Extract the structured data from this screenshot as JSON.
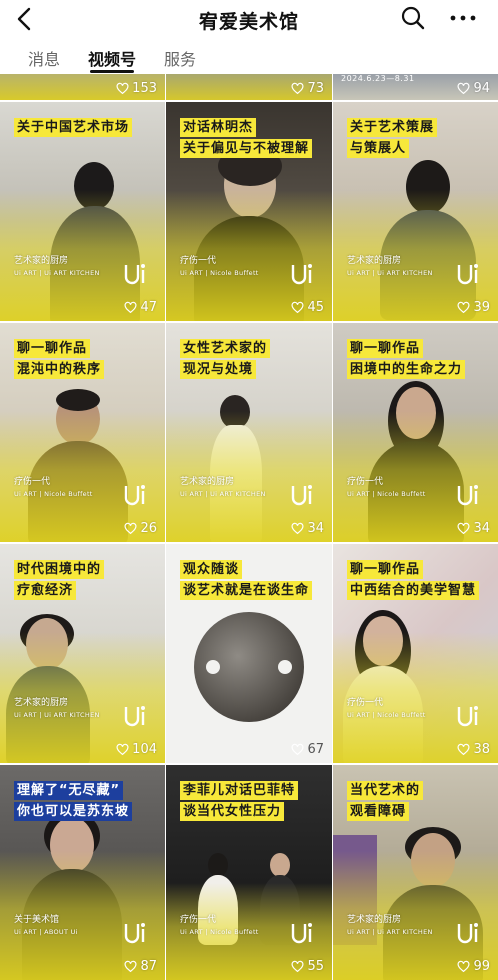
{
  "header": {
    "title": "宥爱美术馆"
  },
  "tabs": [
    {
      "label": "消息",
      "active": false
    },
    {
      "label": "视频号",
      "active": true
    },
    {
      "label": "服务",
      "active": false
    }
  ],
  "top_row": [
    {
      "likes": "153"
    },
    {
      "likes": "73"
    },
    {
      "likes": "94",
      "banner_text": "2024.6.23—8.31"
    }
  ],
  "videos": [
    {
      "caption": [
        "关于中国艺术市场"
      ],
      "series": "艺术家的厨房",
      "series_en": "Ui ART | Ui ART KITCHEN",
      "likes": "47"
    },
    {
      "caption": [
        "对话林明杰",
        "关于偏见与不被理解"
      ],
      "series": "疗伤一代",
      "series_en": "Ui ART | Nicole Buffett",
      "likes": "45"
    },
    {
      "caption": [
        "关于艺术策展",
        "与策展人"
      ],
      "series": "艺术家的厨房",
      "series_en": "Ui ART | Ui ART KITCHEN",
      "likes": "39"
    },
    {
      "caption": [
        "聊一聊作品",
        "混沌中的秩序"
      ],
      "series": "疗伤一代",
      "series_en": "Ui ART | Nicole Buffett",
      "likes": "26"
    },
    {
      "caption": [
        "女性艺术家的",
        "现况与处境"
      ],
      "series": "艺术家的厨房",
      "series_en": "Ui ART | Ui ART KITCHEN",
      "likes": "34"
    },
    {
      "caption": [
        "聊一聊作品",
        "困境中的生命之力"
      ],
      "series": "疗伤一代",
      "series_en": "Ui ART | Nicole Buffett",
      "likes": "34"
    },
    {
      "caption": [
        "时代困境中的",
        "疗愈经济"
      ],
      "series": "艺术家的厨房",
      "series_en": "Ui ART | Ui ART KITCHEN",
      "likes": "104"
    },
    {
      "caption": [
        "观众随谈",
        "谈艺术就是在谈生命"
      ],
      "series": "",
      "series_en": "",
      "likes": "67"
    },
    {
      "caption": [
        "聊一聊作品",
        "中西结合的美学智慧"
      ],
      "series": "疗伤一代",
      "series_en": "Ui ART | Nicole Buffett",
      "likes": "38"
    },
    {
      "caption": [
        "理解了“无尽藏”",
        "你也可以是苏东坡"
      ],
      "caption_style": "blue",
      "series": "关于美术馆",
      "series_en": "Ui ART | ABOUT Ui",
      "likes": "87"
    },
    {
      "caption": [
        "李菲儿对话巴菲特",
        "谈当代女性压力"
      ],
      "series": "疗伤一代",
      "series_en": "Ui ART | Nicole Buffett",
      "likes": "55"
    },
    {
      "caption": [
        "当代艺术的",
        "观看障碍"
      ],
      "series": "艺术家的厨房",
      "series_en": "Ui ART | Ui ART KITCHEN",
      "likes": "99"
    }
  ],
  "icons": {
    "back": "chevron-left-icon",
    "search": "search-icon",
    "more": "more-icon",
    "like": "heart-outline-icon",
    "logo": "ui-logo-icon"
  },
  "colors": {
    "caption_yellow": "#f7e83a",
    "caption_blue": "#1d3f9e",
    "overlay_yellow": "#e0d21e"
  }
}
